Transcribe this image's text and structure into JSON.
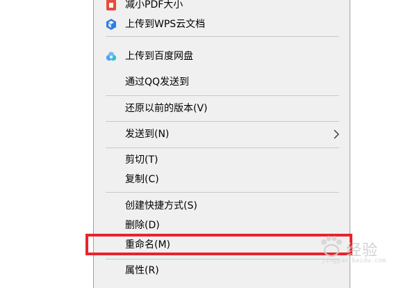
{
  "context_menu": {
    "items": [
      {
        "label": "减小PDF大小",
        "icon": "pdf-reduce-icon"
      },
      {
        "label": "上传到WPS云文档",
        "icon": "wps-cloud-icon"
      },
      {
        "label": "上传到百度网盘",
        "icon": "baidu-netdisk-icon"
      },
      {
        "label": "通过QQ发送到"
      },
      {
        "label": "还原以前的版本(V)"
      },
      {
        "label": "发送到(N)",
        "icon": "chevron-right-icon"
      },
      {
        "label": "剪切(T)"
      },
      {
        "label": "复制(C)"
      },
      {
        "label": "创建快捷方式(S)"
      },
      {
        "label": "删除(D)"
      },
      {
        "label": "重命名(M)"
      },
      {
        "label": "属性(R)"
      }
    ]
  },
  "highlight": {
    "target": "重命名(M)",
    "color": "#e8232b"
  },
  "watermark": {
    "text": "经验",
    "url": "jingyan.baidu.com",
    "icon": "baidu-paw-icon"
  }
}
